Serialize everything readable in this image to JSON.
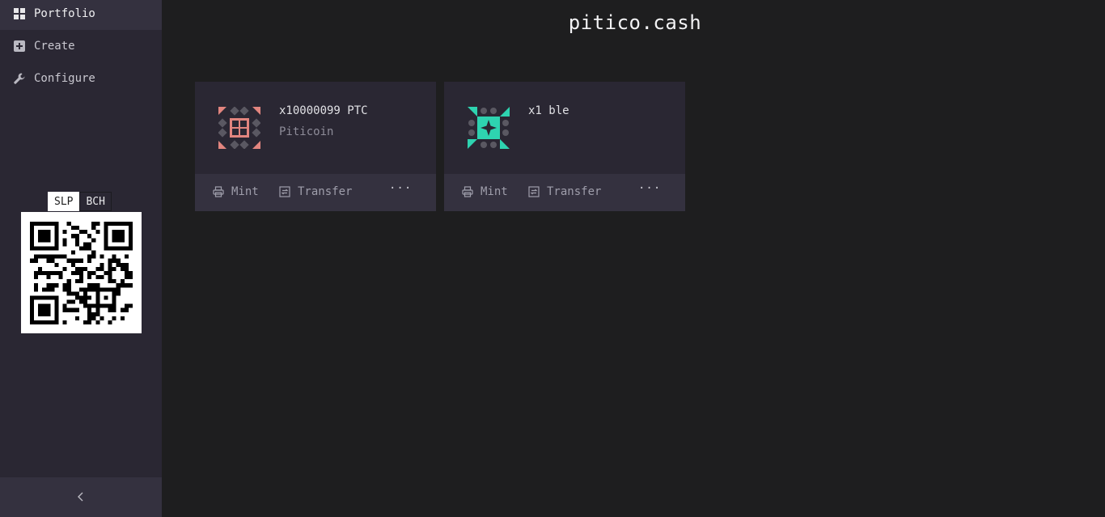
{
  "sidebar": {
    "nav": [
      {
        "label": "Portfolio",
        "icon": "grid-icon",
        "active": true
      },
      {
        "label": "Create",
        "icon": "plus-square-icon",
        "active": false
      },
      {
        "label": "Configure",
        "icon": "wrench-icon",
        "active": false
      }
    ],
    "address_tabs": [
      "SLP",
      "BCH"
    ],
    "active_address_tab": "SLP",
    "collapse_label": "<"
  },
  "header": {
    "title": "pitico.cash"
  },
  "tokens": [
    {
      "quantity": "x10000099 PTC",
      "name": "Piticoin",
      "avatar_color": "#e2857f",
      "actions": {
        "mint": "Mint",
        "transfer": "Transfer",
        "more": "···"
      }
    },
    {
      "quantity": "x1 ble",
      "name": "",
      "avatar_color": "#2ed3b0",
      "actions": {
        "mint": "Mint",
        "transfer": "Transfer",
        "more": "···"
      }
    }
  ],
  "colors": {
    "sidebar_bg": "#2a2733",
    "page_bg": "#1e1e1f",
    "accent_ptc": "#e2857f",
    "accent_ble": "#2ed3b0"
  }
}
